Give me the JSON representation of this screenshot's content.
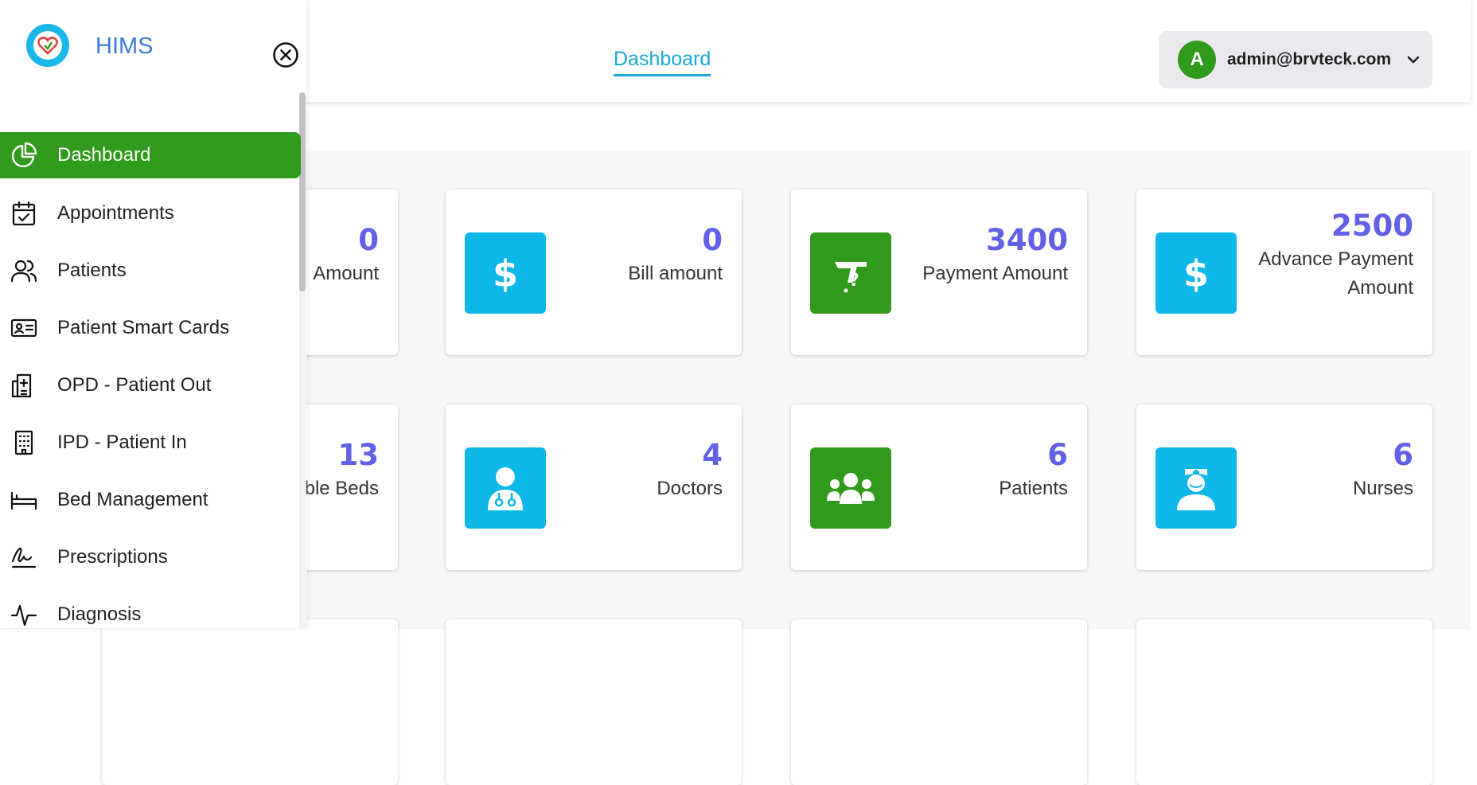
{
  "app": {
    "brand": "HIMS"
  },
  "header": {
    "tab_label": "Dashboard",
    "user": {
      "avatar_initial": "A",
      "email": "admin@brvteck.com"
    }
  },
  "sidebar": {
    "items": [
      {
        "label": "Dashboard",
        "icon": "pie-chart-icon",
        "active": true
      },
      {
        "label": "Appointments",
        "icon": "calendar-check-icon"
      },
      {
        "label": "Patients",
        "icon": "users-icon"
      },
      {
        "label": "Patient Smart Cards",
        "icon": "id-card-icon"
      },
      {
        "label": "OPD - Patient Out",
        "icon": "hospital-icon"
      },
      {
        "label": "IPD - Patient In",
        "icon": "building-icon"
      },
      {
        "label": "Bed Management",
        "icon": "bed-icon"
      },
      {
        "label": "Prescriptions",
        "icon": "signature-icon"
      },
      {
        "label": "Diagnosis",
        "icon": "activity-icon"
      }
    ]
  },
  "cards": [
    {
      "value": "0",
      "label": "Amount",
      "partial_label": "· Amount"
    },
    {
      "value": "0",
      "label": "Bill amount",
      "icon": "dollar-icon",
      "color": "#0db7e8"
    },
    {
      "value": "3400",
      "label": "Payment Amount",
      "icon": "hand-coin-icon",
      "color": "#2f9a1b"
    },
    {
      "value": "2500",
      "label": "Advance Payment Amount",
      "icon": "dollar-icon",
      "color": "#0db7e8"
    },
    {
      "value": "13",
      "label": "Available Beds",
      "partial_label": "ble Beds"
    },
    {
      "value": "4",
      "label": "Doctors",
      "icon": "doctor-icon",
      "color": "#0db7e8"
    },
    {
      "value": "6",
      "label": "Patients",
      "icon": "group-icon",
      "color": "#2f9a1b"
    },
    {
      "value": "6",
      "label": "Nurses",
      "icon": "nurse-icon",
      "color": "#0db7e8"
    }
  ],
  "colors": {
    "accent_green": "#2f9a1b",
    "accent_blue": "#0db7e8",
    "value_purple": "#6160e6",
    "brand_blue": "#3a7bd5"
  }
}
